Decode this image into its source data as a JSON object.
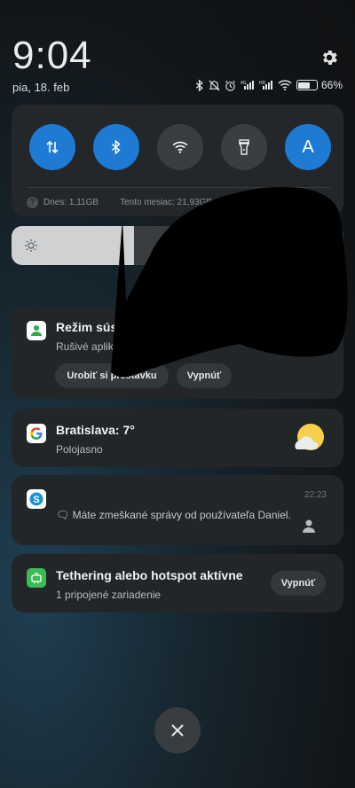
{
  "header": {
    "time": "9:04",
    "date": "pia, 18. feb",
    "battery_percent": "66%",
    "battery_level": 0.66
  },
  "quick_settings": {
    "tiles": [
      {
        "name": "mobile-data",
        "icon": "data-arrows-icon",
        "active": true
      },
      {
        "name": "bluetooth",
        "icon": "bluetooth-icon",
        "active": true
      },
      {
        "name": "wifi",
        "icon": "wifi-icon",
        "active": false
      },
      {
        "name": "flashlight",
        "icon": "flashlight-icon",
        "active": false
      },
      {
        "name": "auto-brightness",
        "icon": "letter-a-icon",
        "label": "A",
        "active": true
      }
    ],
    "data_today": "Dnes: 1,11GB",
    "data_month": "Tento mesiac: 21,93GB",
    "brightness_level": 0.37
  },
  "notifications": {
    "dnd": {
      "title": "Režim sústredenia zapnutý",
      "subtitle": "Rušivé aplikácie sú pozastavené",
      "break_button": "Urobiť si prestávku",
      "off_button": "Vypnúť"
    },
    "weather": {
      "title": "Bratislava: 7°",
      "subtitle": "Polojasno"
    },
    "skype": {
      "time": "22:23",
      "message": "🗨 Máte zmeškané správy od používateľa Daniel."
    },
    "tethering": {
      "title": "Tethering alebo hotspot aktívne",
      "subtitle": "1 pripojené zariadenie",
      "off_button": "Vypnúť"
    }
  },
  "colors": {
    "accent": "#1e7ad3",
    "card": "#222628",
    "panel": "#23272a"
  }
}
